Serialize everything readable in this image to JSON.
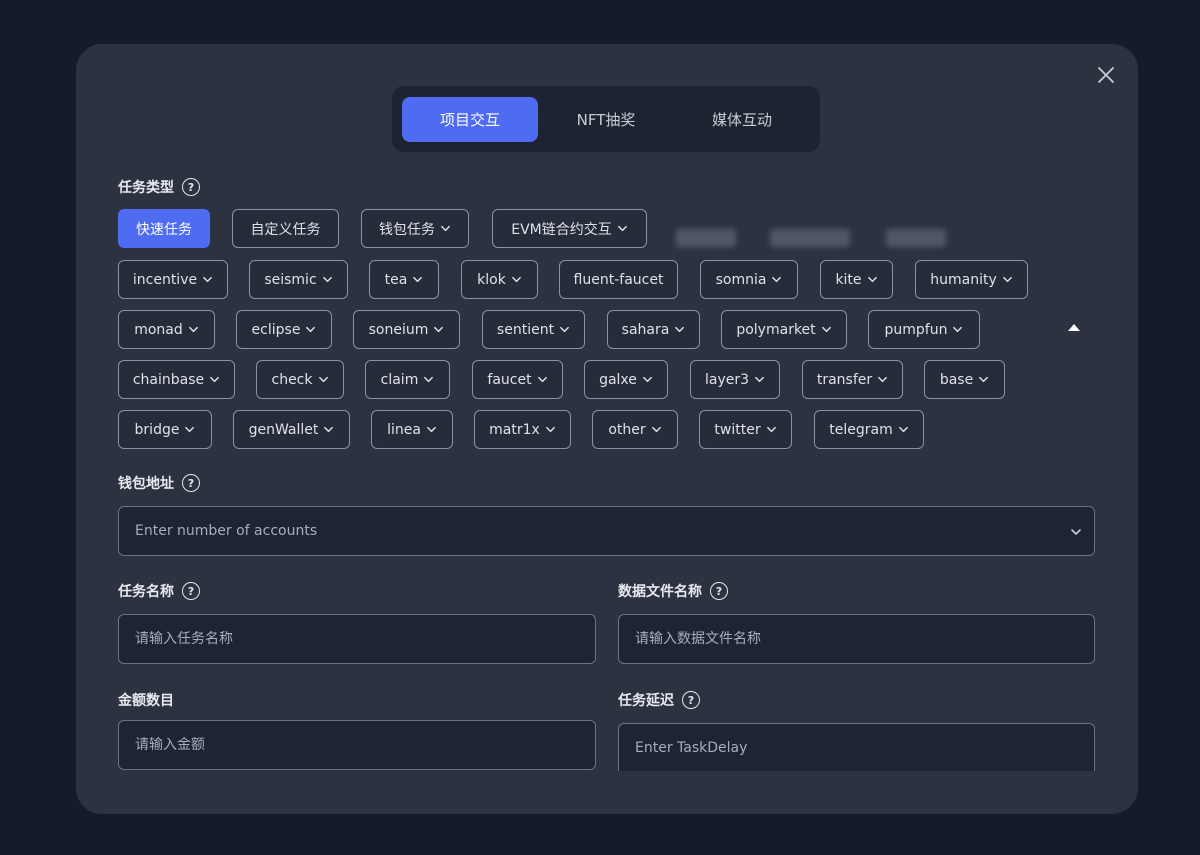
{
  "tabs": [
    {
      "label": "项目交互",
      "active": true
    },
    {
      "label": "NFT抽奖",
      "active": false
    },
    {
      "label": "媒体互动",
      "active": false
    }
  ],
  "task_type": {
    "label": "任务类型",
    "help": "?",
    "row1": [
      {
        "label": "快速任务",
        "dropdown": false,
        "active": true
      },
      {
        "label": "自定义任务",
        "dropdown": false
      },
      {
        "label": "钱包任务",
        "dropdown": true
      },
      {
        "label": "EVM链合约交互",
        "dropdown": true
      }
    ],
    "row2": [
      {
        "label": "incentive",
        "dropdown": true
      },
      {
        "label": "seismic",
        "dropdown": true
      },
      {
        "label": "tea",
        "dropdown": true
      },
      {
        "label": "klok",
        "dropdown": true
      },
      {
        "label": "fluent-faucet",
        "dropdown": false
      },
      {
        "label": "somnia",
        "dropdown": true
      },
      {
        "label": "kite",
        "dropdown": true
      },
      {
        "label": "humanity",
        "dropdown": true
      }
    ],
    "row3": [
      {
        "label": "monad",
        "dropdown": true
      },
      {
        "label": "eclipse",
        "dropdown": true
      },
      {
        "label": "soneium",
        "dropdown": true
      },
      {
        "label": "sentient",
        "dropdown": true
      },
      {
        "label": "sahara",
        "dropdown": true
      },
      {
        "label": "polymarket",
        "dropdown": true
      },
      {
        "label": "pumpfun",
        "dropdown": true
      }
    ],
    "row4": [
      {
        "label": "chainbase",
        "dropdown": true
      },
      {
        "label": "check",
        "dropdown": true
      },
      {
        "label": "claim",
        "dropdown": true
      },
      {
        "label": "faucet",
        "dropdown": true
      },
      {
        "label": "galxe",
        "dropdown": true
      },
      {
        "label": "layer3",
        "dropdown": true
      },
      {
        "label": "transfer",
        "dropdown": true
      },
      {
        "label": "base",
        "dropdown": true
      }
    ],
    "row5": [
      {
        "label": "bridge",
        "dropdown": true
      },
      {
        "label": "genWallet",
        "dropdown": true
      },
      {
        "label": "linea",
        "dropdown": true
      },
      {
        "label": "matr1x",
        "dropdown": true
      },
      {
        "label": "other",
        "dropdown": true
      },
      {
        "label": "twitter",
        "dropdown": true
      },
      {
        "label": "telegram",
        "dropdown": true
      }
    ]
  },
  "wallet": {
    "label": "钱包地址",
    "help": "?",
    "placeholder": "Enter number of accounts"
  },
  "task_name": {
    "label": "任务名称",
    "help": "?",
    "placeholder": "请输入任务名称"
  },
  "data_file": {
    "label": "数据文件名称",
    "help": "?",
    "placeholder": "请输入数据文件名称"
  },
  "amount": {
    "label": "金额数目",
    "placeholder": "请输入金额"
  },
  "task_delay": {
    "label": "任务延迟",
    "help": "?",
    "placeholder": "Enter TaskDelay"
  },
  "colors": {
    "accent": "#4e6bf1",
    "modal_bg": "#2c3240",
    "page_bg": "#151b2b"
  }
}
